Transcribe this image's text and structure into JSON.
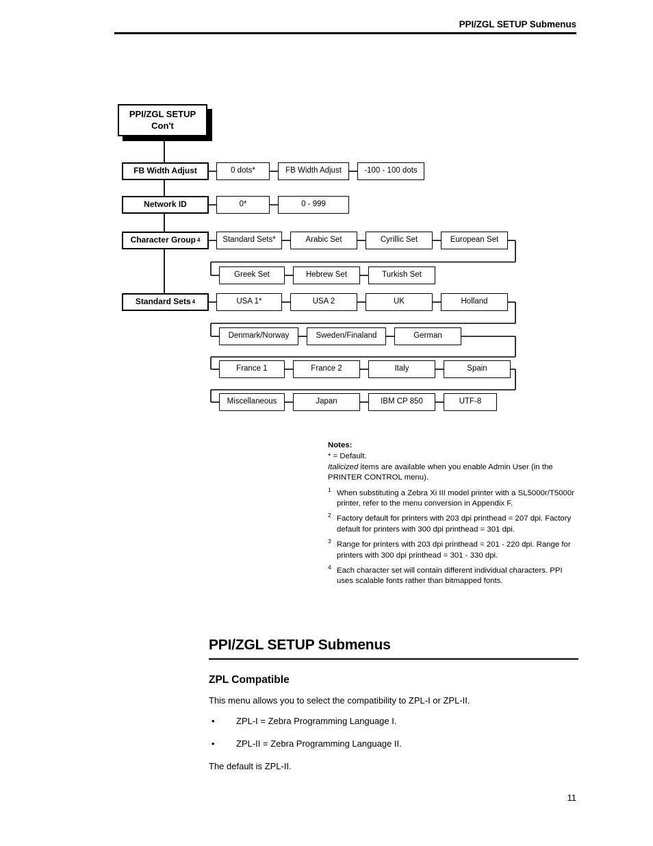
{
  "header": {
    "title": "PPI/ZGL SETUP Submenus"
  },
  "flowchart": {
    "title_node": {
      "line1": "PPI/ZGL SETUP",
      "line2": "Con't"
    },
    "rows": [
      {
        "menu": {
          "label": "FB Width Adjust",
          "superscript": ""
        },
        "options": [
          "0 dots*",
          "FB Width Adjust",
          "-100 - 100 dots"
        ]
      },
      {
        "menu": {
          "label": "Network ID",
          "superscript": ""
        },
        "options": [
          "0*",
          "0 - 999"
        ]
      },
      {
        "menu": {
          "label": "Character Group",
          "superscript": "4"
        },
        "options": [
          "Standard Sets*",
          "Arabic Set",
          "Cyrillic Set",
          "European Set"
        ]
      },
      {
        "menu": null,
        "options": [
          "Greek Set",
          "Hebrew Set",
          "Turkish Set"
        ]
      },
      {
        "menu": {
          "label": "Standard Sets",
          "superscript": "4"
        },
        "options": [
          "USA 1*",
          "USA 2",
          "UK",
          "Holland"
        ]
      },
      {
        "menu": null,
        "options": [
          "Denmark/Norway",
          "Sweden/Finaland",
          "German"
        ]
      },
      {
        "menu": null,
        "options": [
          "France 1",
          "France 2",
          "Italy",
          "Spain"
        ]
      },
      {
        "menu": null,
        "options": [
          "Miscellaneous",
          "Japan",
          "IBM CP 850",
          "UTF-8"
        ]
      }
    ]
  },
  "notes": {
    "title": "Notes:",
    "default_line": "* = Default.",
    "italic_word": "Italicized",
    "italic_rest": " items are available when you enable Admin User (in the PRINTER CONTROL menu).",
    "items": [
      {
        "num": "1",
        "text": "When substituting a Zebra Xi III model printer with a SL5000r/T5000r printer, refer to the menu conversion in Appendix F."
      },
      {
        "num": "2",
        "text": "Factory default for printers with 203 dpi printhead = 207 dpi. Factory default for printers with 300 dpi printhead = 301 dpi."
      },
      {
        "num": "3",
        "text": "Range for printers with 203 dpi printhead = 201 - 220 dpi. Range for printers with 300 dpi printhead = 301 - 330 dpi."
      },
      {
        "num": "4",
        "text": "Each character set will contain different individual characters. PPI uses scalable fonts rather than bitmapped fonts."
      }
    ]
  },
  "body": {
    "heading1": "PPI/ZGL SETUP Submenus",
    "heading2": "ZPL Compatible",
    "intro": "This menu allows you to select the compatibility to ZPL-I or ZPL-II.",
    "bullet_symbol": "•",
    "bullets": [
      "ZPL-I = Zebra Programming Language I.",
      "ZPL-II = Zebra Programming Language II."
    ],
    "closing": "The default is ZPL-II."
  },
  "footer": {
    "page_number": "11"
  }
}
